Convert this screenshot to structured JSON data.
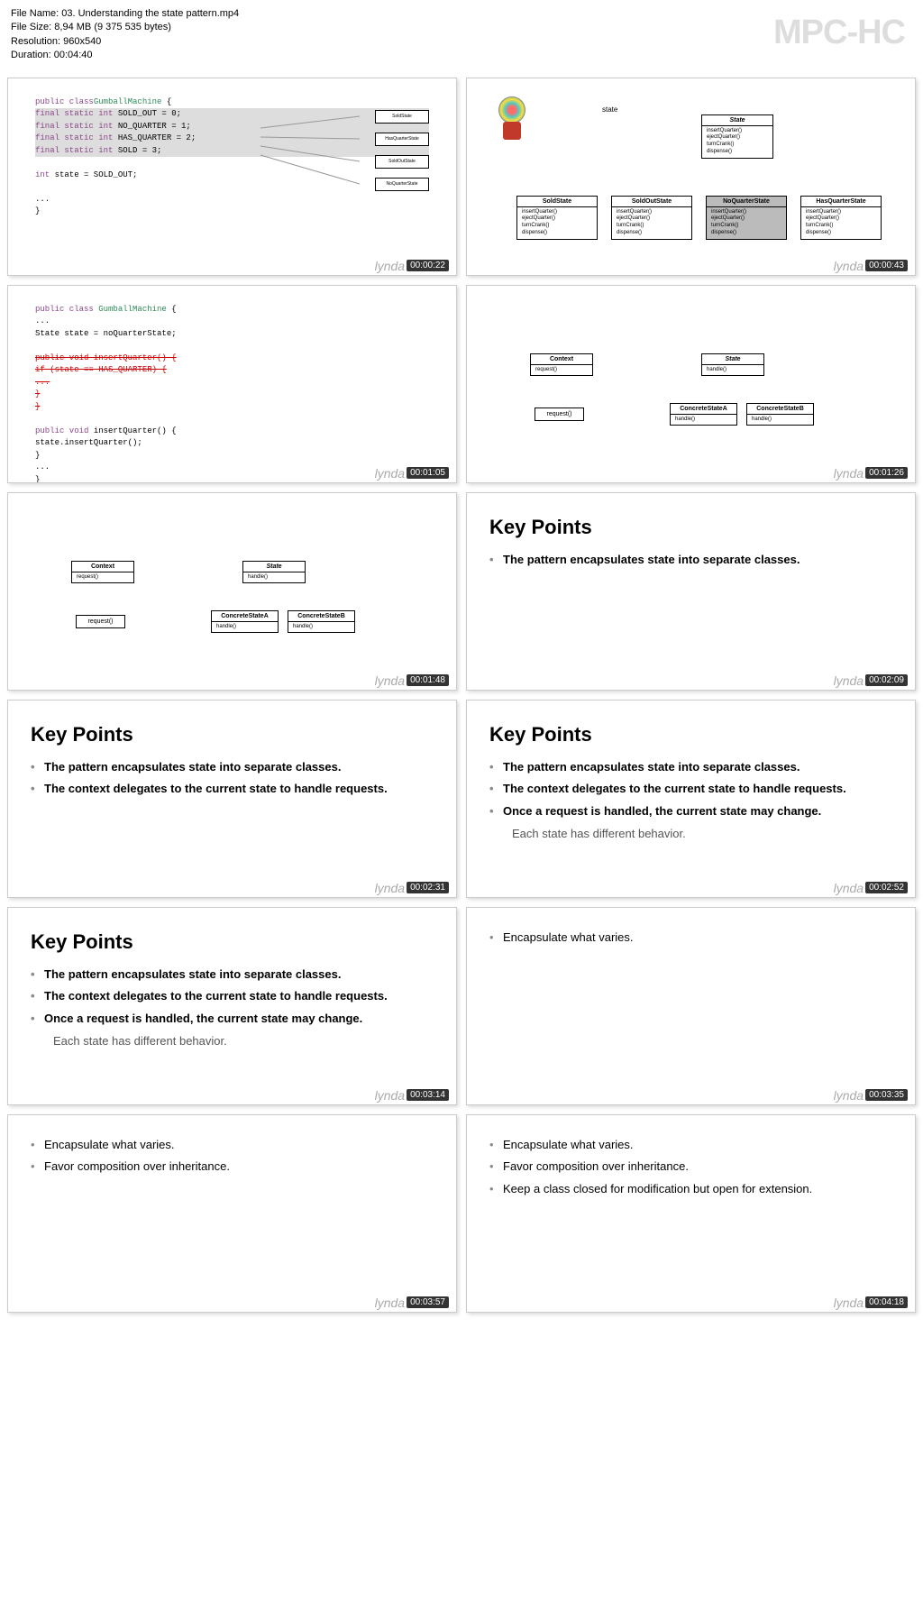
{
  "header": {
    "file_name_label": "File Name: ",
    "file_name": "03. Understanding the state pattern.mp4",
    "file_size_label": "File Size: ",
    "file_size": "8,94 MB (9 375 535 bytes)",
    "resolution_label": "Resolution: ",
    "resolution": "960x540",
    "duration_label": "Duration: ",
    "duration": "00:04:40",
    "watermark": "MPC-HC"
  },
  "brand": "lynda",
  "thumbs": [
    {
      "timestamp": "00:00:22",
      "type": "code",
      "code_lines": [
        {
          "t": "public class",
          "c": "GumballMachine",
          "s": " {"
        },
        {
          "hl": true,
          "t": "  final static int",
          "v": " SOLD_OUT = 0;"
        },
        {
          "hl": true,
          "t": "  final static int",
          "v": " NO_QUARTER = 1;"
        },
        {
          "hl": true,
          "t": "  final static int",
          "v": " HAS_QUARTER = 2;"
        },
        {
          "hl": true,
          "t": "  final static int",
          "v": " SOLD = 3;"
        },
        {
          "blank": true
        },
        {
          "t": "  int",
          "v": " state = SOLD_OUT;"
        },
        {
          "blank": true
        },
        {
          "v": "  ..."
        },
        {
          "v": "}"
        }
      ],
      "side_labels": [
        "SoldState",
        "HasQuarterState",
        "SoldOutState",
        "NoQuarterState"
      ]
    },
    {
      "timestamp": "00:00:43",
      "type": "state-diagram",
      "state_label": "state",
      "root": {
        "name": "State",
        "methods": [
          "insertQuarter()",
          "ejectQuarter()",
          "turnCrank()",
          "dispense()"
        ]
      },
      "children": [
        {
          "name": "SoldState",
          "methods": [
            "insertQuarter()",
            "ejectQuarter()",
            "turnCrank()",
            "dispense()"
          ]
        },
        {
          "name": "SoldOutState",
          "methods": [
            "insertQuarter()",
            "ejectQuarter()",
            "turnCrank()",
            "dispense()"
          ]
        },
        {
          "name": "NoQuarterState",
          "hl": true,
          "methods": [
            "insertQuarter()",
            "ejectQuarter()",
            "turnCrank()",
            "dispense()"
          ]
        },
        {
          "name": "HasQuarterState",
          "methods": [
            "insertQuarter()",
            "ejectQuarter()",
            "turnCrank()",
            "dispense()"
          ]
        }
      ]
    },
    {
      "timestamp": "00:01:05",
      "type": "code2",
      "code_lines": [
        {
          "t": "public class",
          "c": " GumballMachine",
          "s": " {"
        },
        {
          "v": "    ..."
        },
        {
          "v": "    State state = noQuarterState;"
        },
        {
          "blank": true
        },
        {
          "strike": true,
          "v": "    public void insertQuarter() {"
        },
        {
          "strike": true,
          "v": "      if (state == HAS_QUARTER) {"
        },
        {
          "strike": true,
          "v": "        ..."
        },
        {
          "strike": true,
          "v": "      }"
        },
        {
          "strike": true,
          "v": "    }"
        },
        {
          "blank": true
        },
        {
          "t": "    public void",
          "v": " insertQuarter() {"
        },
        {
          "v": "      state.insertQuarter();"
        },
        {
          "v": "    }"
        },
        {
          "v": "    ..."
        },
        {
          "v": "}"
        }
      ]
    },
    {
      "timestamp": "00:01:26",
      "type": "context-diagram",
      "boxes": {
        "context": {
          "name": "Context",
          "method": "request()"
        },
        "state": {
          "name": "State",
          "method": "handle()",
          "italic": true
        },
        "request": {
          "name": "request()"
        },
        "csa": {
          "name": "ConcreteStateA",
          "method": "handle()"
        },
        "csb": {
          "name": "ConcreteStateB",
          "method": "handle()"
        }
      }
    },
    {
      "timestamp": "00:01:48",
      "type": "context-diagram",
      "boxes": {
        "context": {
          "name": "Context",
          "method": "request()"
        },
        "state": {
          "name": "State",
          "method": "handle()",
          "italic": true
        },
        "request": {
          "name": "request()"
        },
        "csa": {
          "name": "ConcreteStateA",
          "method": "handle()"
        },
        "csb": {
          "name": "ConcreteStateB",
          "method": "handle()"
        }
      }
    },
    {
      "timestamp": "00:02:09",
      "type": "key-points",
      "title": "Key Points",
      "points": [
        {
          "text": "The pattern encapsulates state into separate classes.",
          "bold": true
        }
      ]
    },
    {
      "timestamp": "00:02:31",
      "type": "key-points",
      "title": "Key Points",
      "points": [
        {
          "text": "The pattern encapsulates state into separate classes.",
          "bold": true
        },
        {
          "text": "The context delegates to the current state to handle requests.",
          "bold": true
        }
      ]
    },
    {
      "timestamp": "00:02:52",
      "type": "key-points",
      "title": "Key Points",
      "points": [
        {
          "text": "The pattern encapsulates state into separate classes.",
          "bold": true
        },
        {
          "text": "The context delegates to the current state to handle requests.",
          "bold": true
        },
        {
          "text": "Once a request is handled, the current state may change.",
          "bold": true
        },
        {
          "text": "Each state has different behavior.",
          "indent": true
        }
      ]
    },
    {
      "timestamp": "00:03:14",
      "type": "key-points",
      "title": "Key Points",
      "points": [
        {
          "text": "The pattern encapsulates state into separate classes.",
          "bold": true
        },
        {
          "text": "The context delegates to the current state to handle requests.",
          "bold": true
        },
        {
          "text": "Once a request is handled, the current state may change.",
          "bold": true
        },
        {
          "text": "Each state has different behavior.",
          "indent": true
        }
      ]
    },
    {
      "timestamp": "00:03:35",
      "type": "principles",
      "points": [
        {
          "text": "Encapsulate what varies."
        }
      ]
    },
    {
      "timestamp": "00:03:57",
      "type": "principles",
      "points": [
        {
          "text": "Encapsulate what varies."
        },
        {
          "text": "Favor composition over inheritance."
        }
      ]
    },
    {
      "timestamp": "00:04:18",
      "type": "principles",
      "points": [
        {
          "text": "Encapsulate what varies."
        },
        {
          "text": "Favor composition over inheritance."
        },
        {
          "text": "Keep a class closed for modification but open for extension."
        }
      ]
    }
  ]
}
